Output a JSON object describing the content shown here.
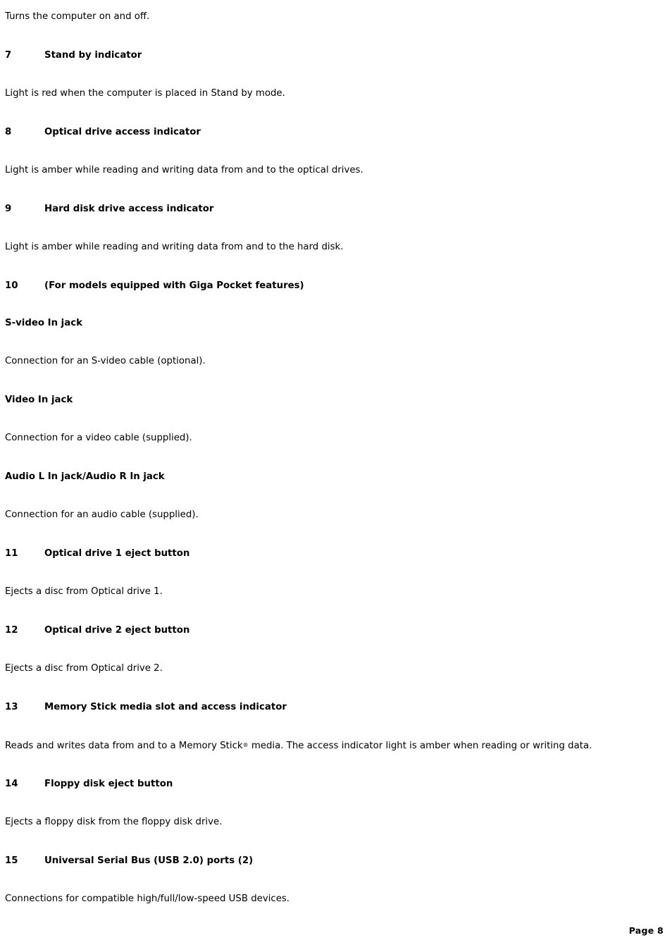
{
  "document": {
    "page_label": "Page 8",
    "blocks": [
      {
        "type": "body",
        "text": "Turns the computer on and off."
      },
      {
        "type": "num-heading",
        "number": "7",
        "label": "Stand by indicator"
      },
      {
        "type": "body",
        "text": "Light is red when the computer is placed in Stand by mode."
      },
      {
        "type": "num-heading",
        "number": "8",
        "label": "Optical drive access indicator"
      },
      {
        "type": "body",
        "text": "Light is amber while reading and writing data from and to the optical drives."
      },
      {
        "type": "num-heading",
        "number": "9",
        "label": "Hard disk drive access indicator"
      },
      {
        "type": "body",
        "text": "Light is amber while reading and writing data from and to the hard disk."
      },
      {
        "type": "num-heading",
        "number": "10",
        "label": "(For models equipped with Giga Pocket features)"
      },
      {
        "type": "sub-heading",
        "label": "S-video In jack"
      },
      {
        "type": "body",
        "text": "Connection for an S-video cable (optional)."
      },
      {
        "type": "sub-heading",
        "label": "Video In jack"
      },
      {
        "type": "body",
        "text": "Connection for a video cable (supplied)."
      },
      {
        "type": "sub-heading",
        "label": "Audio L In jack/Audio R In jack"
      },
      {
        "type": "body",
        "text": "Connection for an audio cable (supplied)."
      },
      {
        "type": "num-heading",
        "number": "11",
        "label": "Optical drive 1 eject button"
      },
      {
        "type": "body",
        "text": "Ejects a disc from Optical drive 1."
      },
      {
        "type": "num-heading",
        "number": "12",
        "label": "Optical drive 2 eject button"
      },
      {
        "type": "body",
        "text": "Ejects a disc from Optical drive 2."
      },
      {
        "type": "num-heading",
        "number": "13",
        "label": "Memory Stick media slot and access indicator"
      },
      {
        "type": "body-reg",
        "text_before": "Reads and writes data from and to a Memory Stick",
        "reg_symbol": "®",
        "text_after": " media. The access indicator light is amber when reading or writing data."
      },
      {
        "type": "num-heading",
        "number": "14",
        "label": "Floppy disk eject button"
      },
      {
        "type": "body",
        "text": "Ejects a floppy disk from the floppy disk drive."
      },
      {
        "type": "num-heading",
        "number": "15",
        "label": "Universal Serial Bus (USB 2.0) ports (2)"
      },
      {
        "type": "body",
        "text": "Connections for compatible high/full/low-speed USB devices."
      }
    ]
  }
}
